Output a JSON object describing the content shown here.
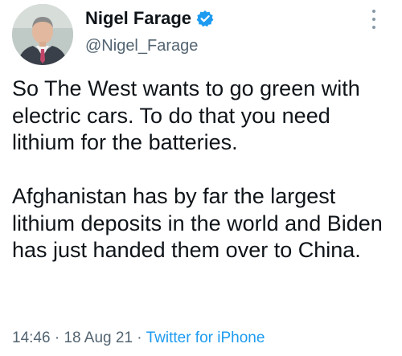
{
  "author": {
    "display_name": "Nigel Farage",
    "handle": "@Nigel_Farage",
    "verified": true
  },
  "tweet": {
    "paragraphs": [
      "So The West wants to go green with electric cars. To do that you need lithium for the batteries.",
      "Afghanistan has by far the largest lithium deposits in the world and Biden has just handed them over to China."
    ]
  },
  "meta": {
    "time": "14:46",
    "separator": " · ",
    "date": "18 Aug 21",
    "source": "Twitter for iPhone"
  },
  "colors": {
    "text": "#0f1419",
    "secondary": "#536471",
    "accent": "#1d9bf0"
  },
  "icons": {
    "verified": "verified-badge-icon",
    "more": "more-vertical-icon"
  }
}
